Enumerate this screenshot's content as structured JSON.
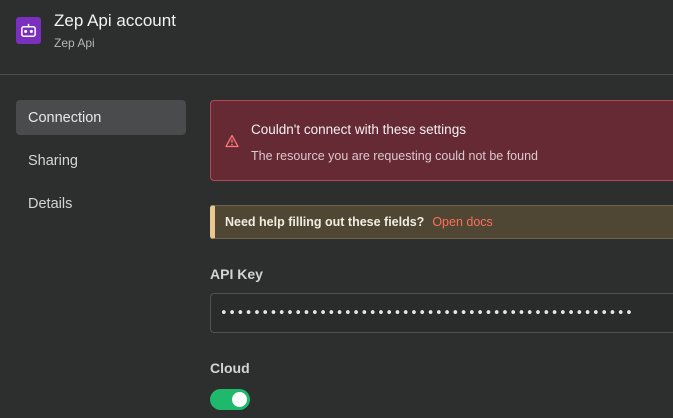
{
  "header": {
    "title": "Zep Api account",
    "subtitle": "Zep Api",
    "logo_icon": "zep-robot-icon",
    "logo_color": "#7b2fbe"
  },
  "sidebar": {
    "items": [
      {
        "label": "Connection",
        "active": true
      },
      {
        "label": "Sharing",
        "active": false
      },
      {
        "label": "Details",
        "active": false
      }
    ]
  },
  "alert": {
    "icon": "warning-triangle-icon",
    "title": "Couldn't connect with these settings",
    "message": "The resource you are requesting could not be found",
    "background": "#652a33",
    "border": "#b44a58"
  },
  "help": {
    "text": "Need help filling out these fields?",
    "link": "Open docs",
    "link_color": "#ff6d5a"
  },
  "fields": {
    "api_key_label": "API Key",
    "api_key_value": "••••••••••••••••••••••••••••••••••••••••••••••••••",
    "cloud_label": "Cloud",
    "cloud_enabled": true,
    "toggle_color": "#1eb96b"
  }
}
